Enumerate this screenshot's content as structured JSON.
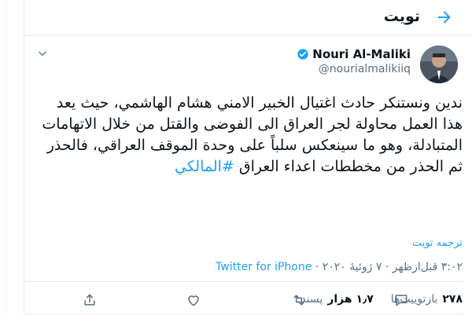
{
  "header": {
    "title": "تويت"
  },
  "tweet": {
    "author_name": "Nouri Al-Maliki",
    "author_handle": "@nourialmalikiiq",
    "text": "ندين ونستنكر حادث اغتيال الخبير الامني هشام الهاشمي، حيث يعد هذا العمل محاولة لجر العراق الى الفوضى والقتل من خلال  الاتهامات المتبادلة، وهو ما سينعكس سلباً على وحدة الموقف العراقي، فالحذر ثم الحذر من مخططات اعداء العراق",
    "hashtag": "#المالكي",
    "translate_label": "ترجمه تويت",
    "time": "٣:٠٢ قبل‌ازظهر",
    "date": "٧ ژوئیهٔ ٢٠٢٠",
    "separator": "·",
    "source": "Twitter for iPhone",
    "retweets_count": "٢٧٨",
    "retweets_label": "بازتوییت‌ها",
    "likes_count": "١٫٧ هزار",
    "likes_label": "پسند"
  },
  "colors": {
    "accent": "#1da1f2",
    "secondary_text": "#5b7083",
    "border": "#e6ecf0"
  },
  "icons": {
    "back": "arrow-right-icon",
    "verified": "verified-badge-icon",
    "more": "chevron-down-icon",
    "reply": "reply-icon",
    "retweet": "retweet-icon",
    "like": "heart-icon",
    "share": "share-icon"
  }
}
